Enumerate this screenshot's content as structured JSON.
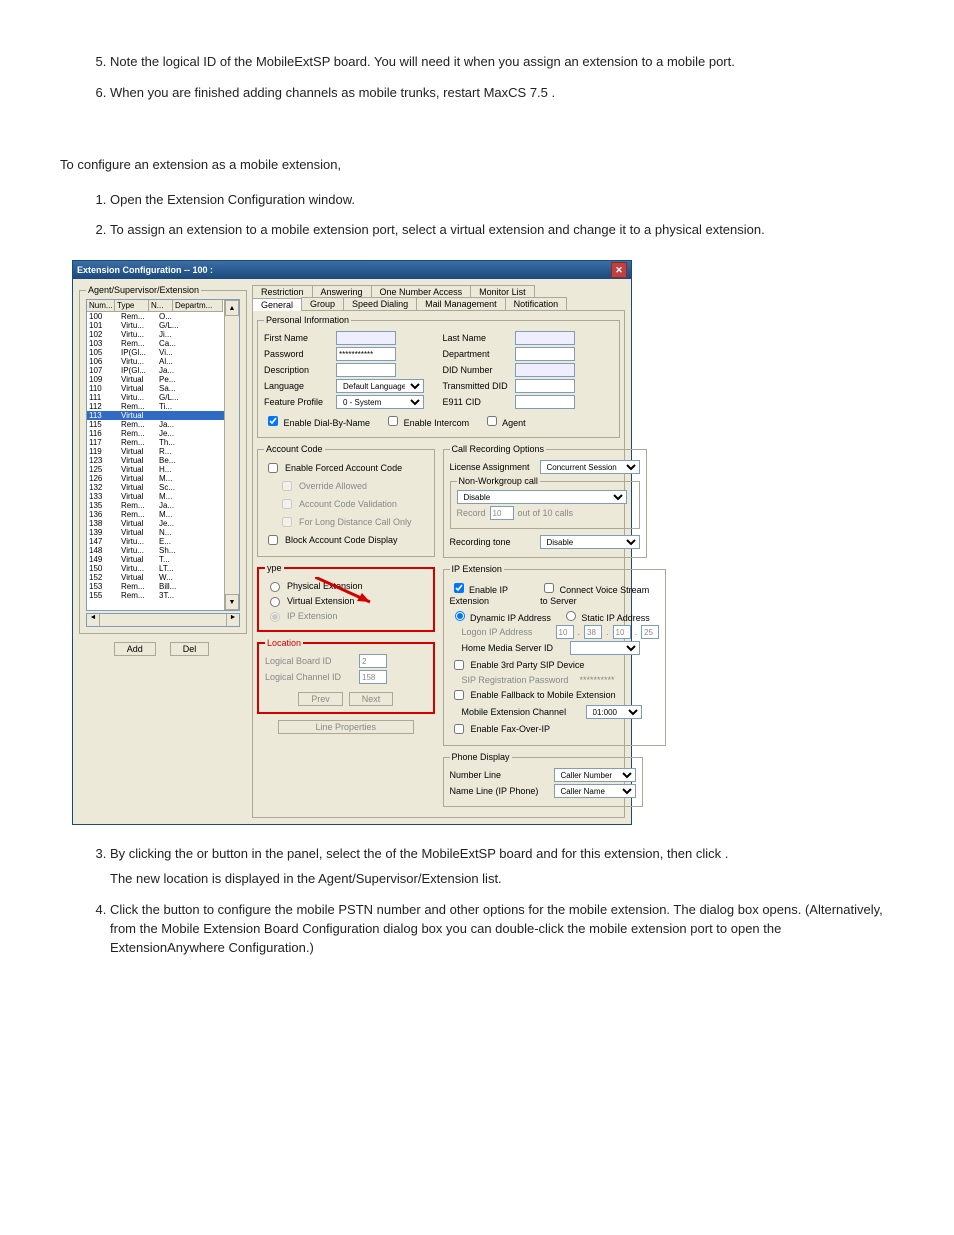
{
  "steps_top": [
    "Note the logical ID of the MobileExtSP board. You will need it when you assign an extension to a mobile port.",
    "When you are finished adding channels as mobile trunks, restart MaxCS 7.5 ."
  ],
  "section_intro": "To configure an extension as a mobile extension,",
  "steps_mid": [
    "Open the Extension Configuration window.",
    "To assign an extension to a mobile extension port, select a virtual extension and change it to a physical extension."
  ],
  "step3": {
    "lead": "By clicking the ",
    "or": " or ",
    "mid": " button in the ",
    "panel_after": " panel, select the ",
    "board_after": " of the MobileExtSP board and ",
    "ext_after": " for this extension, then click ",
    "period": ".",
    "sentence2": "The new location is displayed in the Agent/Supervisor/Extension list."
  },
  "step4": {
    "lead": "Click the ",
    "mid": " button to configure the mobile PSTN number and other options for the mobile extension. The ",
    "after": " dialog box opens. (Alternatively, from the Mobile Extension Board Configuration dialog box you can double-click the mobile extension port to open the ExtensionAnywhere Configuration.)"
  },
  "window": {
    "title": "Extension Configuration -- 100 :",
    "agent_group": "Agent/Supervisor/Extension",
    "cols": {
      "num": "Num...",
      "type": "Type",
      "n": "N...",
      "dep": "Departm..."
    },
    "rows": [
      {
        "num": "100",
        "type": "Rem...",
        "n": "O..."
      },
      {
        "num": "101",
        "type": "Virtu...",
        "n": "G/L..."
      },
      {
        "num": "102",
        "type": "Virtu...",
        "n": "Ji..."
      },
      {
        "num": "103",
        "type": "Rem...",
        "n": "Ca..."
      },
      {
        "num": "105",
        "type": "IP(Gl...",
        "n": "Vi..."
      },
      {
        "num": "106",
        "type": "Virtu...",
        "n": "Al..."
      },
      {
        "num": "107",
        "type": "IP(Gl...",
        "n": "Ja..."
      },
      {
        "num": "109",
        "type": "Virtual",
        "n": "Pe..."
      },
      {
        "num": "110",
        "type": "Virtual",
        "n": "Sa..."
      },
      {
        "num": "111",
        "type": "Virtu...",
        "n": "G/L..."
      },
      {
        "num": "112",
        "type": "Rem...",
        "n": "Ti..."
      },
      {
        "num": "113",
        "type": "Virtual",
        "n": ""
      },
      {
        "num": "115",
        "type": "Rem...",
        "n": "Ja..."
      },
      {
        "num": "116",
        "type": "Rem...",
        "n": "Je..."
      },
      {
        "num": "117",
        "type": "Rem...",
        "n": "Th..."
      },
      {
        "num": "119",
        "type": "Virtual",
        "n": "R..."
      },
      {
        "num": "123",
        "type": "Virtual",
        "n": "Be..."
      },
      {
        "num": "125",
        "type": "Virtual",
        "n": "H..."
      },
      {
        "num": "126",
        "type": "Virtual",
        "n": "M..."
      },
      {
        "num": "132",
        "type": "Virtual",
        "n": "Sc..."
      },
      {
        "num": "133",
        "type": "Virtual",
        "n": "M..."
      },
      {
        "num": "135",
        "type": "Rem...",
        "n": "Ja..."
      },
      {
        "num": "136",
        "type": "Rem...",
        "n": "M..."
      },
      {
        "num": "138",
        "type": "Virtual",
        "n": "Je..."
      },
      {
        "num": "139",
        "type": "Virtual",
        "n": "N..."
      },
      {
        "num": "147",
        "type": "Virtu...",
        "n": "E..."
      },
      {
        "num": "148",
        "type": "Virtu...",
        "n": "Sh..."
      },
      {
        "num": "149",
        "type": "Virtual",
        "n": "T..."
      },
      {
        "num": "150",
        "type": "Virtu...",
        "n": "LT..."
      },
      {
        "num": "152",
        "type": "Virtual",
        "n": "W..."
      },
      {
        "num": "153",
        "type": "Rem...",
        "n": "Bill..."
      },
      {
        "num": "155",
        "type": "Rem...",
        "n": "3T..."
      }
    ],
    "selected_row": 11,
    "btn_add": "Add",
    "btn_del": "Del",
    "tabs_row1": [
      "Restriction",
      "Answering",
      "One Number Access",
      "Monitor List"
    ],
    "tabs_row2": [
      "General",
      "Group",
      "Speed Dialing",
      "Mail Management",
      "Notification"
    ],
    "personal_legend": "Personal Information",
    "labels": {
      "first": "First Name",
      "last": "Last Name",
      "password": "Password",
      "department": "Department",
      "description": "Description",
      "did": "DID Number",
      "language": "Language",
      "transdid": "Transmitted DID",
      "feature": "Feature Profile",
      "e911": "E911 CID"
    },
    "password_value": "***********",
    "language_value": "Default Language",
    "feature_value": "0 - System",
    "chk_dial_by_name": "Enable Dial-By-Name",
    "chk_intercom": "Enable Intercom",
    "chk_agent": "Agent",
    "account_legend": "Account Code",
    "account": {
      "forced": "Enable Forced Account Code",
      "override": "Override Allowed",
      "validation": "Account Code Validation",
      "ld": "For Long Distance Call Only",
      "block": "Block Account Code Display"
    },
    "call_rec_legend": "Call Recording Options",
    "call_rec": {
      "license": "License Assignment",
      "license_value": "Concurrent Session",
      "nonwg": "Non-Workgroup call",
      "disable": "Disable",
      "record": "Record",
      "record_suffix": "out of 10 calls",
      "record_value": "10",
      "tone": "Recording tone",
      "tone_value": "Disable"
    },
    "type_legend": "ype",
    "type": {
      "physical": "Physical Extension",
      "virtual": "Virtual Extension",
      "ip": "IP Extension"
    },
    "ipext_legend": "IP Extension",
    "ipext": {
      "enable": "Enable IP Extension",
      "connect": "Connect Voice Stream to Server",
      "dynamic": "Dynamic IP Address",
      "static": "Static IP Address",
      "logon": "Logon IP Address",
      "ip": [
        "10",
        "38",
        "10",
        "25"
      ],
      "media": "Home Media Server ID",
      "thirdparty": "Enable 3rd Party SIP Device",
      "sippw": "SIP Registration Password",
      "sippw_value": "**********",
      "fallback": "Enable Fallback to Mobile Extension",
      "mobile_ch": "Mobile Extension Channel",
      "mobile_ch_value": "01:000",
      "fax": "Enable Fax-Over-IP"
    },
    "location_legend": "Location",
    "location": {
      "board": "Logical Board ID",
      "board_value": "2",
      "channel": "Logical Channel ID",
      "channel_value": "158",
      "prev": "Prev",
      "next": "Next"
    },
    "phone_legend": "Phone Display",
    "phone": {
      "number_line": "Number Line",
      "number_value": "Caller Number",
      "name_line": "Name Line (IP Phone)",
      "name_value": "Caller Name"
    },
    "btn_line_props": "Line Properties"
  }
}
